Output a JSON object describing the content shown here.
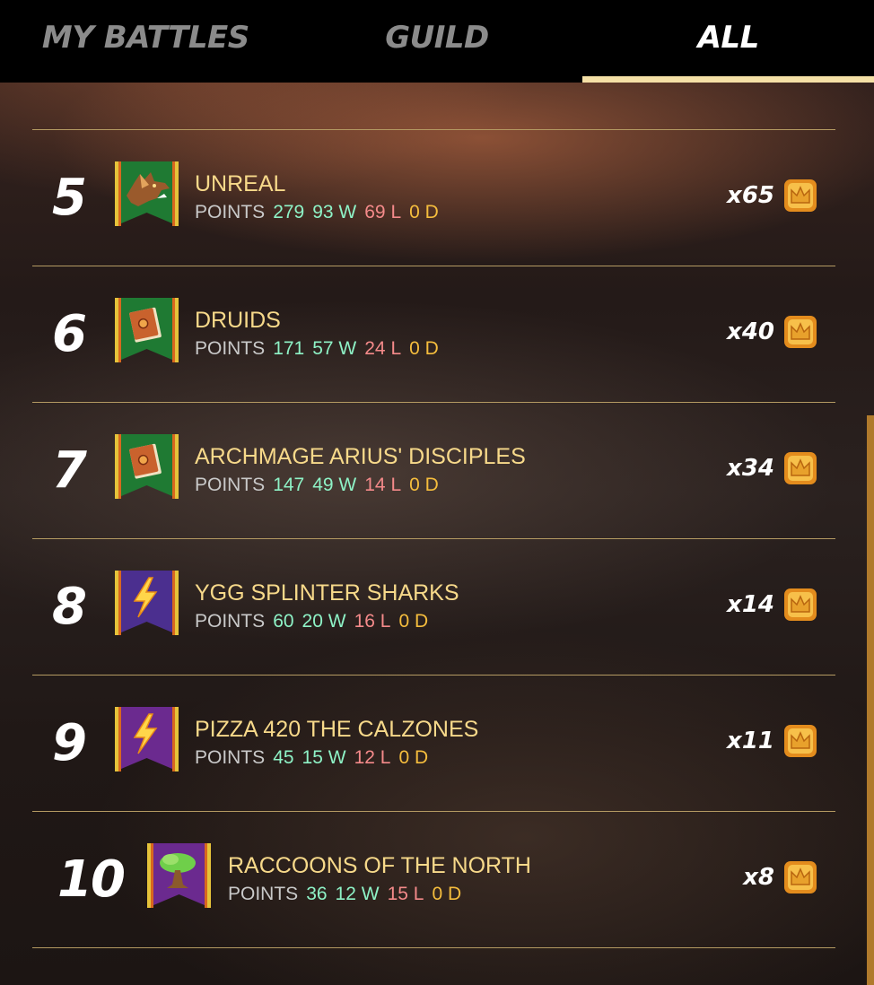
{
  "tabs": [
    {
      "label": "MY BATTLES",
      "active": false
    },
    {
      "label": "GUILD",
      "active": false
    },
    {
      "label": "ALL",
      "active": true
    }
  ],
  "rows": [
    {
      "rank": "5",
      "name": "UNREAL",
      "points_label": "POINTS",
      "points": "279",
      "wins": "93 W",
      "losses": "69 L",
      "draws": "0 D",
      "reward": "x65",
      "emblem_icon": "wolf-icon",
      "banner_color": "#1f7a33"
    },
    {
      "rank": "6",
      "name": "DRUIDS",
      "points_label": "POINTS",
      "points": "171",
      "wins": "57 W",
      "losses": "24 L",
      "draws": "0 D",
      "reward": "x40",
      "emblem_icon": "spellbook-icon",
      "banner_color": "#1f7a33"
    },
    {
      "rank": "7",
      "name": "ARCHMAGE ARIUS' DISCIPLES",
      "points_label": "POINTS",
      "points": "147",
      "wins": "49 W",
      "losses": "14 L",
      "draws": "0 D",
      "reward": "x34",
      "emblem_icon": "spellbook-icon",
      "banner_color": "#1f7a33"
    },
    {
      "rank": "8",
      "name": "YGG SPLINTER SHARKS",
      "points_label": "POINTS",
      "points": "60",
      "wins": "20 W",
      "losses": "16 L",
      "draws": "0 D",
      "reward": "x14",
      "emblem_icon": "lightning-icon",
      "banner_color": "#4b2f8f"
    },
    {
      "rank": "9",
      "name": "PIZZA 420 THE CALZONES",
      "points_label": "POINTS",
      "points": "45",
      "wins": "15 W",
      "losses": "12 L",
      "draws": "0 D",
      "reward": "x11",
      "emblem_icon": "lightning-icon",
      "banner_color": "#6b2a8f"
    },
    {
      "rank": "10",
      "name": "RACCOONS OF THE NORTH",
      "points_label": "POINTS",
      "points": "36",
      "wins": "12 W",
      "losses": "15 L",
      "draws": "0 D",
      "reward": "x8",
      "emblem_icon": "tree-icon",
      "banner_color": "#6b2a8f"
    }
  ],
  "colors": {
    "name": "#f7d98a",
    "wins": "#8ef2c6",
    "losses": "#f48a8a",
    "draws": "#f5bd3d",
    "active_tab_underline": "#f5e0a6",
    "divider": "#b49a62"
  },
  "reward_icon": "crown-chest-icon"
}
